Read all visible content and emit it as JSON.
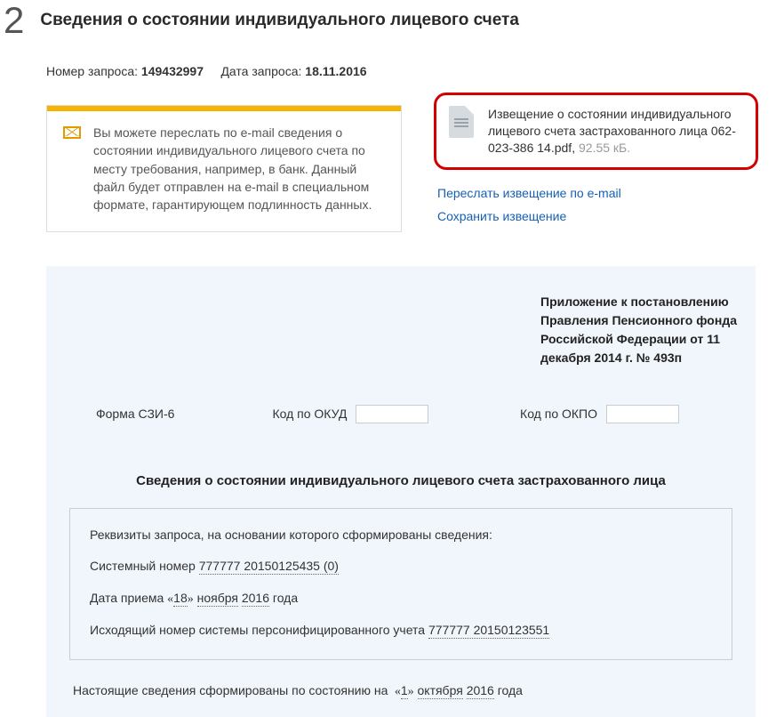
{
  "step": "2",
  "title": "Сведения о состоянии индивидуального лицевого счета",
  "meta": {
    "request_label": "Номер запроса:",
    "request_num": "149432997",
    "date_label": "Дата запроса:",
    "date": "18.11.2016"
  },
  "note": "Вы можете переслать по e-mail сведения о состоянии индивидуального лицевого счета по месту требования, например, в банк. Данный файл будет отправлен на e-mail в специальном формате, гарантирующем подлинность данных.",
  "file": {
    "name": "Извещение о состоянии индивидуального лицевого счета застрахованного лица 062-023-386 14.pdf",
    "size": "92.55 кБ."
  },
  "links": {
    "forward": "Переслать извещение по e-mail",
    "save": "Сохранить извещение"
  },
  "annex": "Приложение к постановлению Правления Пенсионного фонда Российской Федерации от 11 декабря 2014 г. № 493п",
  "form": {
    "name": "Форма СЗИ-6",
    "okud_label": "Код по ОКУД",
    "okud": "",
    "okpo_label": "Код по ОКПО",
    "okpo": ""
  },
  "doc_title": "Сведения о состоянии индивидуального лицевого счета застрахованного лица",
  "req": {
    "intro": "Реквизиты запроса, на основании которого сформированы сведения:",
    "sys_label": "Системный номер",
    "sys_num": "777777 20150125435 (0)",
    "accept_prefix": "Дата приема",
    "accept_day": "18",
    "accept_month": "ноября",
    "accept_year": "2016",
    "accept_suffix": "года",
    "outgoing_label": "Исходящий номер системы персонифицированного учета",
    "outgoing_num": "777777 20150123551"
  },
  "footer": {
    "prefix": "Настоящие сведения сформированы по состоянию на",
    "day": "1",
    "month": "октября",
    "year": "2016",
    "suffix": "года"
  }
}
